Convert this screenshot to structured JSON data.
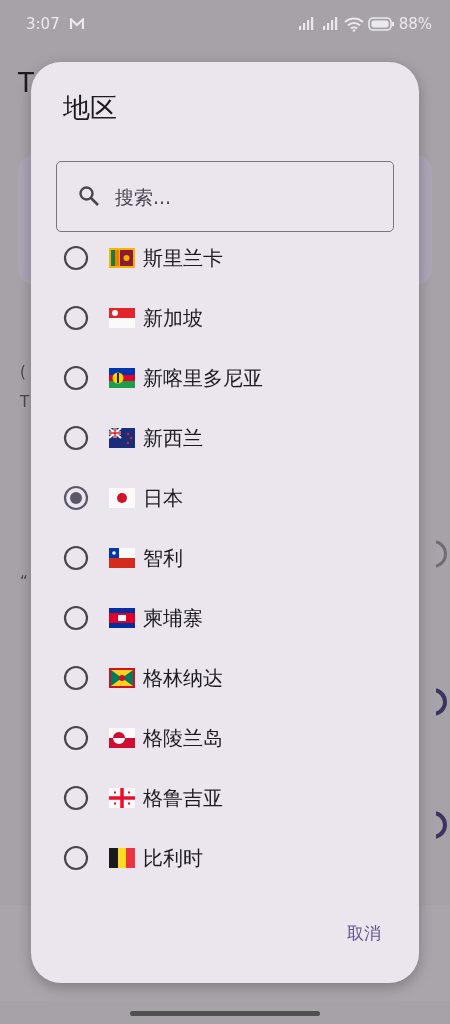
{
  "status_bar": {
    "time": "3:07",
    "battery": "88%"
  },
  "background": {
    "app_bar_title": "T",
    "fragments": [
      {
        "text": "("
      },
      {
        "text": "T"
      },
      {
        "text": "“"
      }
    ],
    "switches": [
      {
        "on": false
      },
      {
        "on": true
      },
      {
        "on": true
      }
    ]
  },
  "dialog": {
    "title": "地区",
    "search": {
      "placeholder": "搜索..."
    },
    "options": [
      {
        "label": "斯里兰卡",
        "kind": "lk",
        "selected": false
      },
      {
        "label": "新加坡",
        "kind": "sg",
        "selected": false
      },
      {
        "label": "新喀里多尼亚",
        "kind": "nc",
        "selected": false
      },
      {
        "label": "新西兰",
        "kind": "nz",
        "selected": false
      },
      {
        "label": "日本",
        "kind": "jp",
        "selected": true
      },
      {
        "label": "智利",
        "kind": "cl",
        "selected": false
      },
      {
        "label": "柬埔寨",
        "kind": "kh",
        "selected": false
      },
      {
        "label": "格林纳达",
        "kind": "gd",
        "selected": false
      },
      {
        "label": "格陵兰岛",
        "kind": "gl",
        "selected": false
      },
      {
        "label": "格鲁吉亚",
        "kind": "ge",
        "selected": false
      },
      {
        "label": "比利时",
        "kind": "be",
        "selected": false
      }
    ],
    "cancel": "取消"
  }
}
